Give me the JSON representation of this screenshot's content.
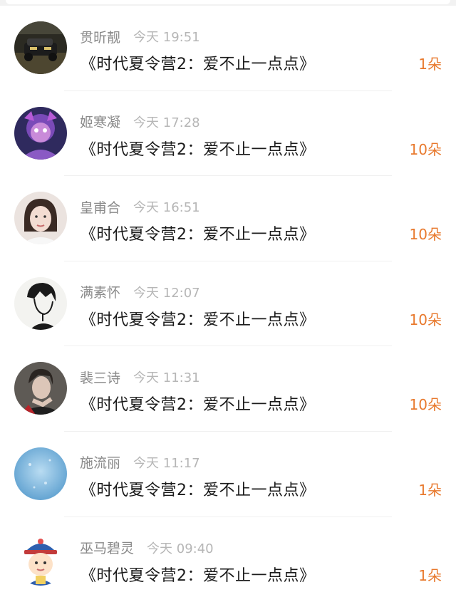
{
  "records": [
    {
      "name": "贯昕靓",
      "time": "今天 19:51",
      "title": "《时代夏令营2：爱不止一点点》",
      "gift": "1朵",
      "avatar": "car-photo-avatar",
      "avatar_colors": [
        "#2b2a22",
        "#8c7a3a"
      ]
    },
    {
      "name": "姬寒凝",
      "time": "今天 17:28",
      "title": "《时代夏令营2：爱不止一点点》",
      "gift": "10朵",
      "avatar": "purple-character-avatar",
      "avatar_colors": [
        "#3b2b6a",
        "#b65ad6"
      ]
    },
    {
      "name": "皇甫合",
      "time": "今天 16:51",
      "title": "《时代夏令营2：爱不止一点点》",
      "gift": "10朵",
      "avatar": "woman-portrait-avatar",
      "avatar_colors": [
        "#e9ddd8",
        "#3a2a24"
      ]
    },
    {
      "name": "满素怀",
      "time": "今天 12:07",
      "title": "《时代夏令营2：爱不止一点点》",
      "gift": "10朵",
      "avatar": "anime-boy-sketch-avatar",
      "avatar_colors": [
        "#f3f3f0",
        "#1a1a1a"
      ]
    },
    {
      "name": "裴三诗",
      "time": "今天 11:31",
      "title": "《时代夏令营2：爱不止一点点》",
      "gift": "10朵",
      "avatar": "man-portrait-avatar",
      "avatar_colors": [
        "#5e5a55",
        "#d8c4b6"
      ]
    },
    {
      "name": "施流丽",
      "time": "今天 11:17",
      "title": "《时代夏令营2：爱不止一点点》",
      "gift": "1朵",
      "avatar": "blue-texture-avatar",
      "avatar_colors": [
        "#9cc7e6",
        "#5c9fcf"
      ]
    },
    {
      "name": "巫马碧灵",
      "time": "今天 09:40",
      "title": "《时代夏令营2：爱不止一点点》",
      "gift": "1朵",
      "avatar": "cartoon-official-avatar",
      "avatar_colors": [
        "#ffffff",
        "#2f5fae"
      ]
    }
  ]
}
